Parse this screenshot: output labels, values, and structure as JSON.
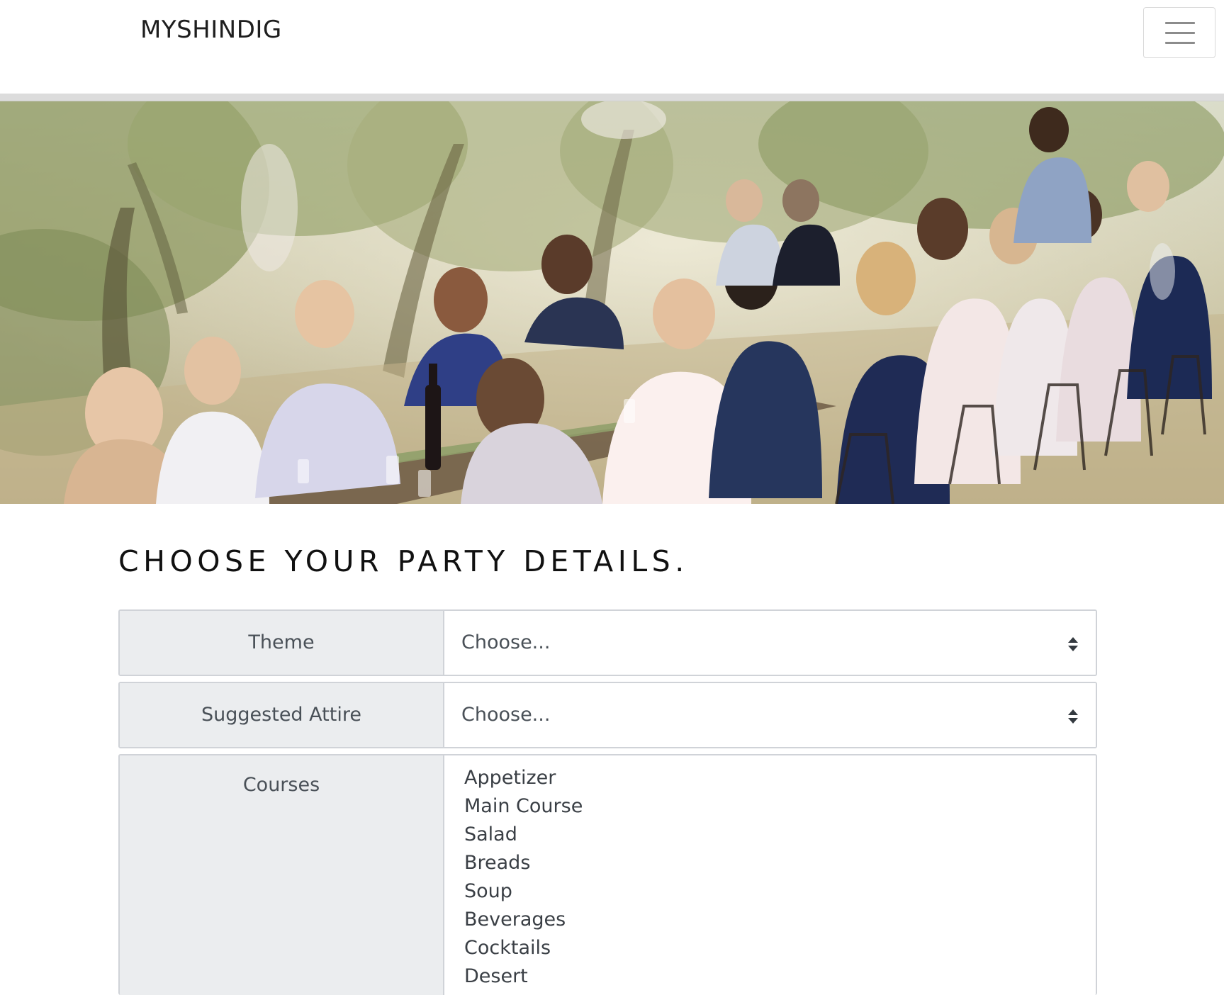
{
  "navbar": {
    "brand": "MYSHINDIG",
    "toggler_icon": "hamburger-menu-icon"
  },
  "hero": {
    "image_description": "Outdoor dinner party at a long table among olive trees"
  },
  "form": {
    "title": "CHOOSE YOUR PARTY DETAILS.",
    "theme": {
      "label": "Theme",
      "selected": "Choose..."
    },
    "attire": {
      "label": "Suggested Attire",
      "selected": "Choose..."
    },
    "courses": {
      "label": "Courses",
      "options": [
        "Appetizer",
        "Main Course",
        "Salad",
        "Breads",
        "Soup",
        "Beverages",
        "Cocktails",
        "Desert"
      ]
    },
    "select_arrow_icon": "select-arrows-icon"
  }
}
